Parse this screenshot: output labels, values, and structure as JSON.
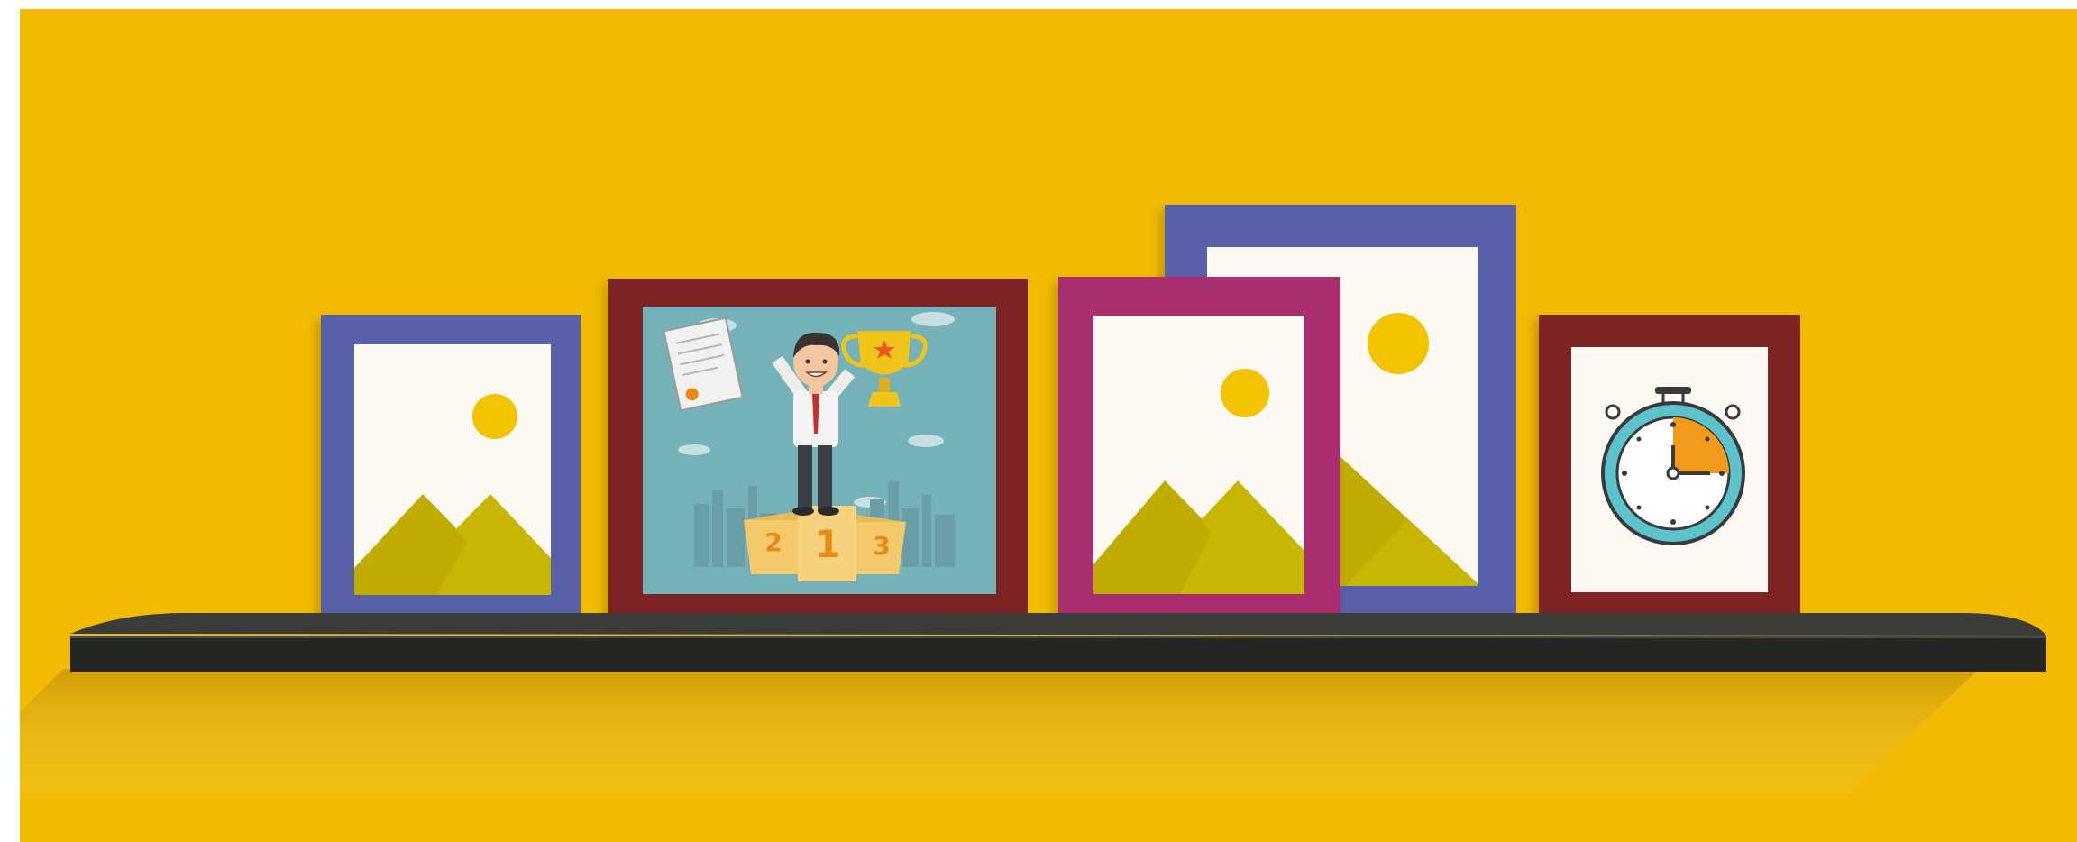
{
  "scene": {
    "colors": {
      "wall": "#f2bb02",
      "shelf_top": "#3b3c3a",
      "shelf_front": "#262725",
      "shelf_shadow": "#dcae12",
      "picture_bg": "#fcf8f2",
      "mountain_back": "#c3af01",
      "mountain_front": "#c7b603",
      "sun": "#f4c300"
    },
    "frames": [
      {
        "name": "frame-blue-small",
        "color": "#5860a7",
        "content": "landscape"
      },
      {
        "name": "frame-winner",
        "color": "#7d2323",
        "content": "winner-illustration"
      },
      {
        "name": "frame-blue-large",
        "color": "#5860a7",
        "content": "landscape"
      },
      {
        "name": "frame-magenta",
        "color": "#a92d6f",
        "content": "landscape"
      },
      {
        "name": "frame-stopwatch",
        "color": "#7d2323",
        "content": "stopwatch"
      }
    ],
    "winner_illustration": {
      "background": "#75b1b9",
      "trophy_color": "#f0c419",
      "podium_color": "#f4c96a",
      "podium_labels": {
        "first": "1",
        "second": "2",
        "third": "3"
      }
    },
    "stopwatch": {
      "ring_color": "#5cc3cd",
      "elapsed_fraction": 0.25,
      "elapsed_color": "#f29a19"
    }
  }
}
